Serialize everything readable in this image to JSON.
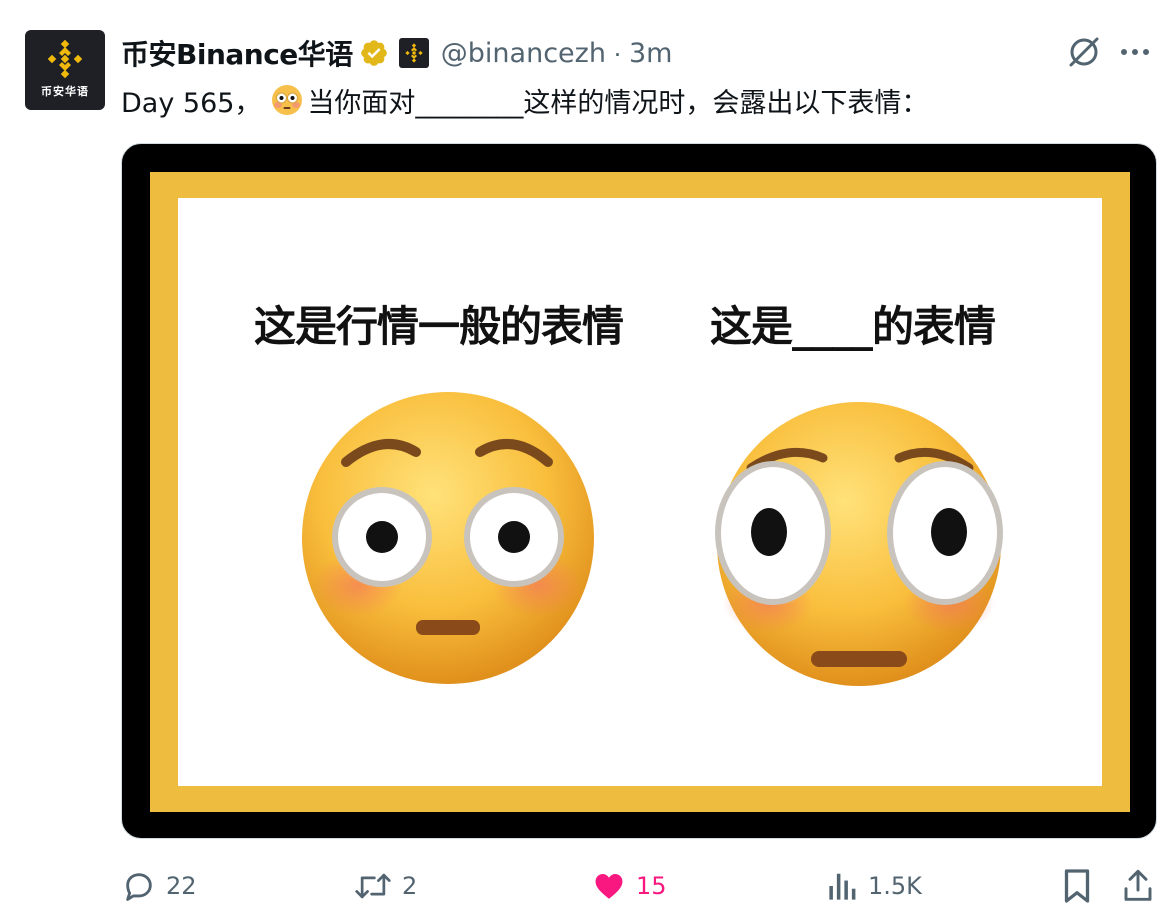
{
  "author": {
    "display_name": "币安Binance华语",
    "handle": "@binancezh",
    "separator": "·",
    "time": "3m",
    "avatar_text": "币安华语"
  },
  "tweet": {
    "text_before_emoji": "Day 565，",
    "text_after_emoji": "当你面对________这样的情况时，会露出以下表情："
  },
  "media": {
    "left_caption": "这是行情一般的表情",
    "right_caption": "这是____的表情"
  },
  "actions": {
    "reply_count": "22",
    "retweet_count": "2",
    "like_count": "15",
    "view_count": "1.5K"
  },
  "icons": {
    "verified": "verified-badge-icon",
    "affiliate": "binance-logo-icon",
    "grok": "grok-icon",
    "more": "more-icon",
    "reply": "reply-icon",
    "retweet": "retweet-icon",
    "like": "heart-icon",
    "views": "views-icon",
    "bookmark": "bookmark-icon",
    "share": "share-icon"
  },
  "colors": {
    "like_active": "#f91880",
    "muted_text": "#536471",
    "brand_yellow": "#eebd40",
    "avatar_bg": "#1e2026"
  }
}
